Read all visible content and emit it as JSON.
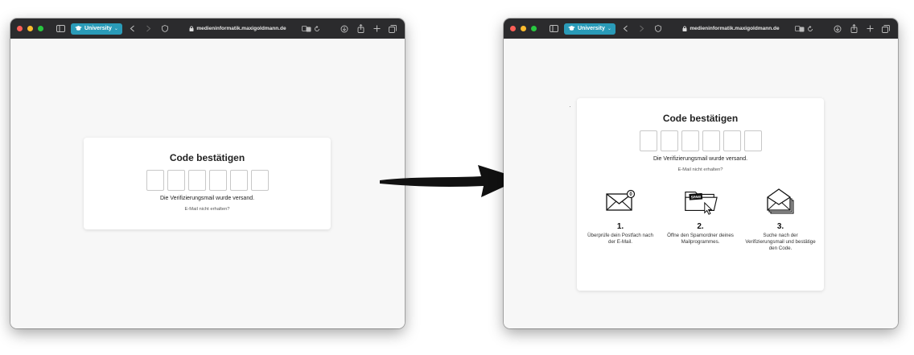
{
  "browser": {
    "tab_group_label": "University",
    "address": "medieninformatik.maxigoldmann.de"
  },
  "before": {
    "card_title": "Code bestätigen",
    "code_boxes": 6,
    "sent_message": "Die Verifizierungsmail wurde versand.",
    "resend_link": "E-Mail nicht erhalten?"
  },
  "after": {
    "card_title": "Code bestätigen",
    "code_boxes": 6,
    "sent_message": "Die Verifizierungsmail wurde versand.",
    "resend_link": "E-Mail nicht erhalten?",
    "steps": [
      {
        "number": "1.",
        "text": "Überprüfe dein Postfach nach der E-Mail.",
        "icon": "envelope-icon"
      },
      {
        "number": "2.",
        "text": "Öffne den Spamordner deines Mailprogrammes.",
        "icon": "spam-folder-icon",
        "folder_label": "SPAM"
      },
      {
        "number": "3.",
        "text": "Suche nach der Verifizierungsmail und bestätige den Code.",
        "icon": "open-envelope-stack-icon"
      }
    ]
  },
  "colors": {
    "tab_group": "#2a9bb8",
    "titlebar": "#2b2b2d",
    "page_bg": "#f7f7f7"
  }
}
